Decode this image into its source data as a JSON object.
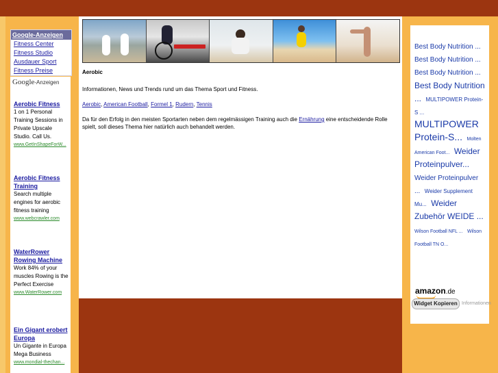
{
  "colors": {
    "header": "#9c3510",
    "side": "#f7b54a",
    "link": "#1a1aa0",
    "ad_url": "#2a8a2a"
  },
  "ad_menu": {
    "heading": "Google-Anzeigen",
    "items": [
      "Fitness Center",
      "Fitness Studio",
      "Ausdauer Sport",
      "Fitness Preise"
    ]
  },
  "google_label": {
    "logo": "Google",
    "suffix": "-Anzeigen"
  },
  "ads": [
    {
      "title": "Aerobic Fitness",
      "body": "1 on 1 Personal Training Sessions in Private Upscale Studio. Call Us.",
      "url": "www.GetInShapeForW..."
    },
    {
      "title": "Aerobic Fitness Training",
      "body": "Search multiple engines for aerobic fitness training",
      "url": "www.webcrawler.com"
    },
    {
      "title": "WaterRower Rowing Machine",
      "body": "Work 84% of your muscles Rowing is the Perfect Exercise",
      "url": "www.WaterRower.com"
    },
    {
      "title": "Ein Gigant erobert Europa",
      "body": "Un Gigante in Europa Mega Business",
      "url": "www.mondial-thechan..."
    }
  ],
  "content": {
    "title": "Aerobic",
    "intro": "Informationen, News und Trends rund um das Thema Sport und Fitness.",
    "links": [
      "Aerobic",
      "American Football",
      "Formel 1",
      "Rudern",
      "Tennis"
    ],
    "para_before": "Da für den Erfolg in den meisten Sportarten neben dem regelmässigen Training auch die ",
    "para_link": "Ernährung",
    "para_after": " eine entscheidende Rolle spielt, soll dieses Thema hier natürlich auch behandelt werden."
  },
  "cloud": [
    {
      "text": "Best Body Nutrition ...",
      "size": "s1"
    },
    {
      "text": "Best Body Nutrition ...",
      "size": "s1"
    },
    {
      "text": "Best Body Nutrition ...",
      "size": "s1"
    },
    {
      "text": "Best Body Nutrition ...",
      "size": "s2"
    },
    {
      "text": "MULTIPOWER Protein-S ...",
      "size": "s4"
    },
    {
      "text": "MULTIPOWER Protein-S...",
      "size": "s3"
    },
    {
      "text": "Molten American Foot...",
      "size": "s5"
    },
    {
      "text": "Weider Proteinpulver...",
      "size": "s2"
    },
    {
      "text": "Weider Proteinpulver ...",
      "size": "s1"
    },
    {
      "text": "Weider Supplement Mu...",
      "size": "s4"
    },
    {
      "text": "Weider Zubehör WEIDE ...",
      "size": "s2"
    },
    {
      "text": "Wilson Football NFL ...",
      "size": "s5"
    },
    {
      "text": "Wilson Football TN O...",
      "size": "s5"
    }
  ],
  "amazon": {
    "brand": "amazon",
    "tld": ".de"
  },
  "widget_button": "Widget Kopieren",
  "info_link": "Informationen"
}
